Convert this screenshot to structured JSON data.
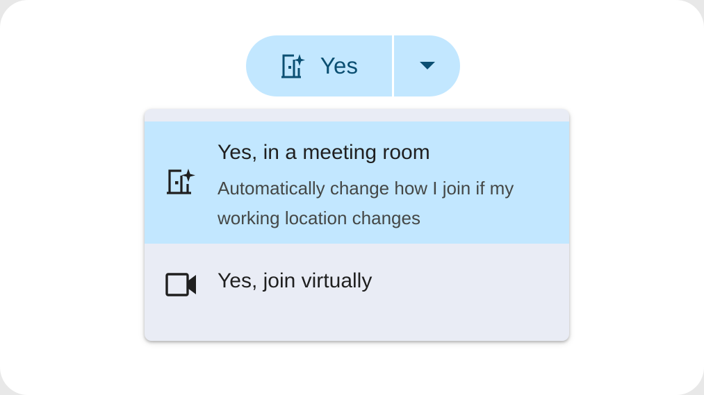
{
  "rsvp_button": {
    "label": "Yes",
    "icon": "meeting-room-sparkle-icon",
    "dropdown_icon": "caret-down-icon"
  },
  "menu": {
    "items": [
      {
        "title": "Yes, in a meeting room",
        "description": "Automatically change how I join if my working location changes",
        "icon": "meeting-room-sparkle-icon",
        "selected": true
      },
      {
        "title": "Yes, join virtually",
        "icon": "videocam-icon",
        "selected": false
      }
    ]
  },
  "colors": {
    "button_bg": "#c2e7ff",
    "button_text": "#0b4f72",
    "menu_bg": "#e9ecf5",
    "selected_bg": "#c2e7ff",
    "text_primary": "#1f1f1f",
    "text_secondary": "#444746"
  }
}
